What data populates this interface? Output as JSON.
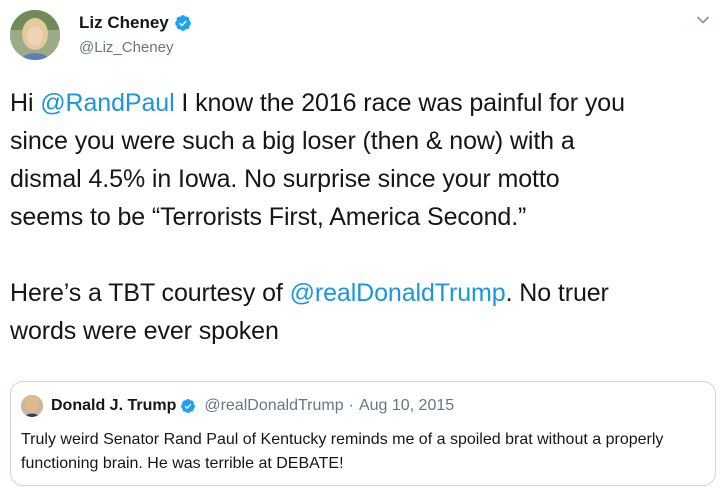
{
  "author": {
    "name": "Liz Cheney",
    "handle": "@Liz_Cheney"
  },
  "tweet": {
    "lines": [
      {
        "parts": [
          {
            "t": "Hi ",
            "m": false
          },
          {
            "t": "@RandPaul",
            "m": true
          },
          {
            "t": " I know the 2016 race was painful for you",
            "m": false
          }
        ]
      },
      {
        "parts": [
          {
            "t": "since you were such a big loser (then & now) with a",
            "m": false
          }
        ]
      },
      {
        "parts": [
          {
            "t": "dismal 4.5% in Iowa. No surprise since your motto",
            "m": false
          }
        ]
      },
      {
        "parts": [
          {
            "t": "seems to be “Terrorists First, America Second.”",
            "m": false
          }
        ]
      },
      {
        "parts": [
          {
            "t": "",
            "m": false
          }
        ]
      },
      {
        "parts": [
          {
            "t": "Here’s a TBT courtesy of ",
            "m": false
          },
          {
            "t": "@realDonaldTrump",
            "m": true
          },
          {
            "t": ". No truer",
            "m": false
          }
        ]
      },
      {
        "parts": [
          {
            "t": "words were ever spoken",
            "m": false
          }
        ]
      }
    ]
  },
  "quote": {
    "name": "Donald J. Trump",
    "handle": "@realDonaldTrump",
    "separator": "·",
    "date": "Aug 10, 2015",
    "text": "Truly weird Senator Rand Paul of Kentucky reminds me of a spoiled brat without a properly functioning brain. He was terrible at DEBATE!"
  },
  "colors": {
    "mention": "#1b95e0",
    "verified": "#1da1f2",
    "secondary": "#657786"
  },
  "icons": [
    "verified-badge-icon",
    "chevron-down-icon"
  ]
}
